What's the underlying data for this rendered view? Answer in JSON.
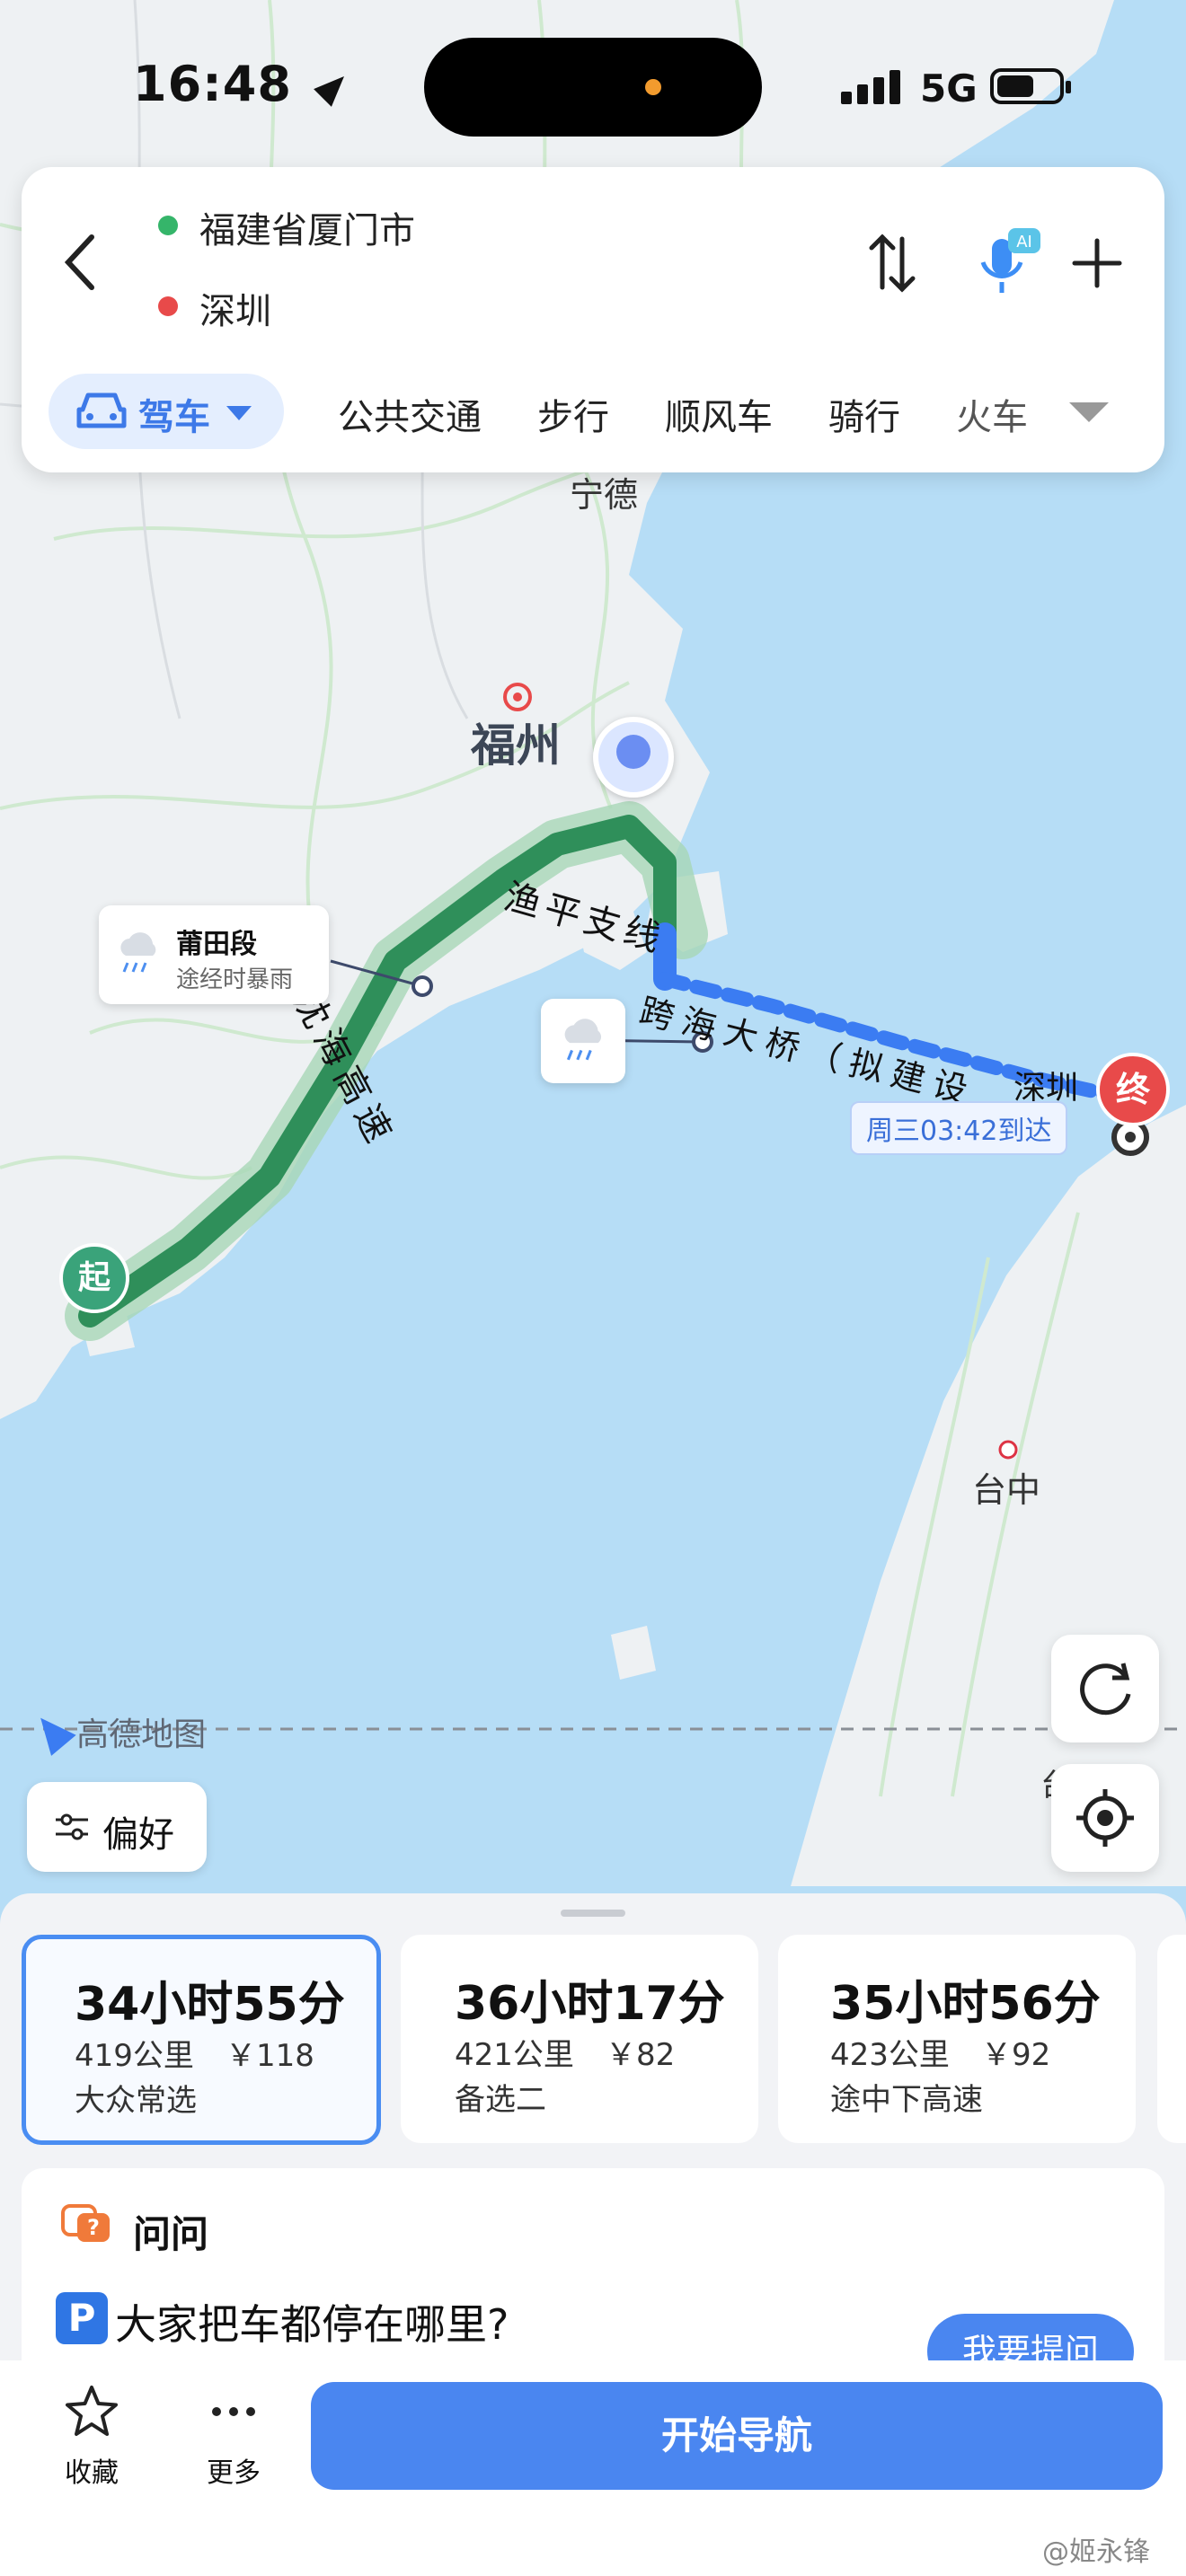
{
  "status_bar": {
    "time": "16:48",
    "network": "5G"
  },
  "route_header": {
    "origin": "福建省厦门市",
    "destination": "深圳",
    "modes": [
      {
        "label": "驾车",
        "active": true
      },
      {
        "label": "公共交通"
      },
      {
        "label": "步行"
      },
      {
        "label": "顺风车"
      },
      {
        "label": "骑行"
      },
      {
        "label": "火车"
      }
    ]
  },
  "map": {
    "cities": {
      "ningde": "宁德",
      "fuzhou": "福州",
      "taizhong": "台中",
      "tai_partial": "台",
      "shenzhen": "深圳"
    },
    "roads": {
      "yuping": "渔平支线",
      "shenhai": "沈海高速",
      "bridge": "跨海大桥（拟建设"
    },
    "weather_callout": {
      "title": "莆田段",
      "subtitle": "途经时暴雨"
    },
    "arrival": "周三03:42到达",
    "start_marker": "起",
    "end_marker": "终",
    "logo": "高德地图",
    "preference_button": "偏好"
  },
  "routes": [
    {
      "time": "34小时55分",
      "distance": "419公里",
      "cost": "￥118",
      "tag": "大众常选",
      "selected": true
    },
    {
      "time": "36小时17分",
      "distance": "421公里",
      "cost": "￥82",
      "tag": "备选二"
    },
    {
      "time": "35小时56分",
      "distance": "423公里",
      "cost": "￥92",
      "tag": "途中下高速"
    }
  ],
  "ask": {
    "title": "问问",
    "question": "大家把车都停在哪里?",
    "ask_button": "我要提问"
  },
  "bottom": {
    "favorite": "收藏",
    "more": "更多",
    "start_nav": "开始导航",
    "watermark": "@姬永锋"
  },
  "colors": {
    "accent": "#4a86f0",
    "route_green": "#2f8f5a",
    "route_blue": "#3b7cf2",
    "end_red": "#e84a4a"
  }
}
